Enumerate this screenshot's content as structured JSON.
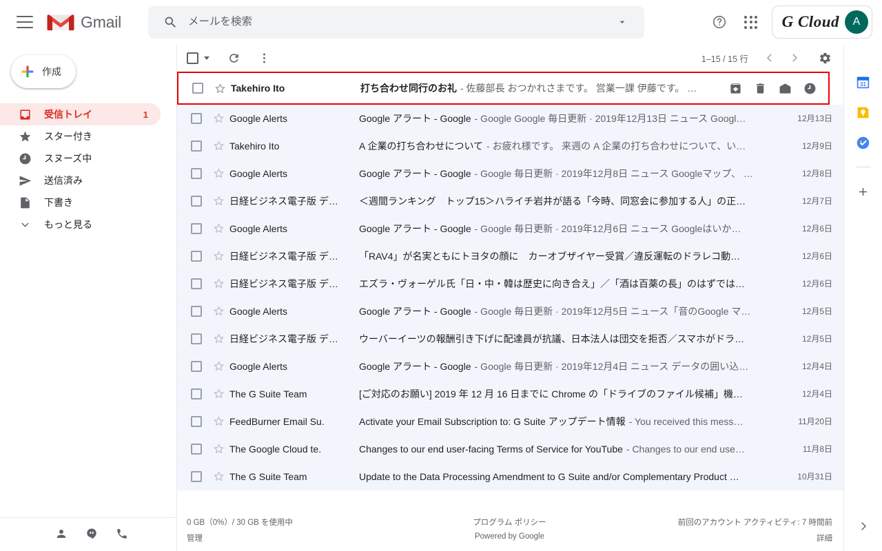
{
  "header": {
    "menu_icon": "hamburger-menu-icon",
    "brand": "Gmail",
    "search": {
      "placeholder": "メールを検索",
      "value": "",
      "icon": "search-icon",
      "options_icon": "chevron-down-icon"
    },
    "help_icon": "help-circle-icon",
    "apps_icon": "apps-grid-icon",
    "account": {
      "logo_text": "G Cloud",
      "avatar_initial": "A"
    }
  },
  "sidebar": {
    "compose_label": "作成",
    "items": [
      {
        "label": "受信トレイ",
        "icon": "inbox-icon",
        "count": "1",
        "active": true
      },
      {
        "label": "スター付き",
        "icon": "star-icon",
        "count": "",
        "active": false
      },
      {
        "label": "スヌーズ中",
        "icon": "clock-icon",
        "count": "",
        "active": false
      },
      {
        "label": "送信済み",
        "icon": "send-icon",
        "count": "",
        "active": false
      },
      {
        "label": "下書き",
        "icon": "draft-file-icon",
        "count": "",
        "active": false
      },
      {
        "label": "もっと見る",
        "icon": "chevron-down-icon",
        "count": "",
        "active": false
      }
    ],
    "footer_icons": [
      "contacts-person-icon",
      "hangouts-chat-icon",
      "phone-icon"
    ]
  },
  "toolbar": {
    "select_all_icon": "checkbox-icon",
    "select_all_caret_icon": "chevron-down-icon",
    "refresh_icon": "refresh-icon",
    "more_icon": "more-vertical-icon",
    "pagination_text": "1–15 / 15 行",
    "prev_icon": "chevron-left-icon",
    "next_icon": "chevron-right-icon",
    "settings_icon": "gear-icon"
  },
  "highlight_color": "#ea0000",
  "row_actions": [
    {
      "icon": "archive-icon"
    },
    {
      "icon": "trash-icon"
    },
    {
      "icon": "mark-as-read-envelope-icon"
    },
    {
      "icon": "snooze-clock-icon"
    }
  ],
  "emails": [
    {
      "sender": "Takehiro Ito",
      "subject": "打ち合わせ同行のお礼",
      "snippet": "- 佐藤部長 おつかれさまです。 営業一課 伊藤です。 …",
      "date": "",
      "unread": true,
      "highlighted": true
    },
    {
      "sender": "Google Alerts",
      "subject": "Google アラート - Google",
      "snippet": "- Google Google 毎日更新 · 2019年12月13日 ニュース Googl…",
      "date": "12月13日",
      "unread": false,
      "highlighted": false
    },
    {
      "sender": "Takehiro Ito",
      "subject": "A 企業の打ち合わせについて",
      "snippet": "- お疲れ様です。 来週の A 企業の打ち合わせについて、い…",
      "date": "12月9日",
      "unread": false,
      "highlighted": false
    },
    {
      "sender": "Google Alerts",
      "subject": "Google アラート - Google",
      "snippet": "- Google 毎日更新 · 2019年12月8日 ニュース Googleマップ、 …",
      "date": "12月8日",
      "unread": false,
      "highlighted": false
    },
    {
      "sender": "日経ビジネス電子版 デ…",
      "subject": "＜週間ランキング　トップ15＞ハライチ岩井が語る「今時、同窓会に参加する人」の正…",
      "snippet": "",
      "date": "12月7日",
      "unread": false,
      "highlighted": false
    },
    {
      "sender": "Google Alerts",
      "subject": "Google アラート - Google",
      "snippet": "- Google 毎日更新 · 2019年12月6日 ニュース Googleはいか…",
      "date": "12月6日",
      "unread": false,
      "highlighted": false
    },
    {
      "sender": "日経ビジネス電子版 デ…",
      "subject": "「RAV4」が名実ともにトヨタの顔に　カーオブザイヤー受賞／違反運転のドラレコ動…",
      "snippet": "",
      "date": "12月6日",
      "unread": false,
      "highlighted": false
    },
    {
      "sender": "日経ビジネス電子版 デ…",
      "subject": "エズラ・ヴォーゲル氏「日・中・韓は歴史に向き合え」／「酒は百薬の長」のはずでは…",
      "snippet": "",
      "date": "12月6日",
      "unread": false,
      "highlighted": false
    },
    {
      "sender": "Google Alerts",
      "subject": "Google アラート - Google",
      "snippet": "- Google 毎日更新 · 2019年12月5日 ニュース「音のGoogle マ…",
      "date": "12月5日",
      "unread": false,
      "highlighted": false
    },
    {
      "sender": "日経ビジネス電子版 デ…",
      "subject": "ウーバーイーツの報酬引き下げに配達員が抗議、日本法人は団交を拒否／スマホがドラ…",
      "snippet": "",
      "date": "12月5日",
      "unread": false,
      "highlighted": false
    },
    {
      "sender": "Google Alerts",
      "subject": "Google アラート - Google",
      "snippet": "- Google 毎日更新 · 2019年12月4日 ニュース データの囲い込…",
      "date": "12月4日",
      "unread": false,
      "highlighted": false
    },
    {
      "sender": "The G Suite Team",
      "subject": "[ご対応のお願い] 2019 年 12 月 16 日までに Chrome の「ドライブのファイル候補」機…",
      "snippet": "",
      "date": "12月4日",
      "unread": false,
      "highlighted": false
    },
    {
      "sender": "FeedBurner Email Su.",
      "subject": "Activate your Email Subscription to: G Suite アップデート情報",
      "snippet": "- You received this mess…",
      "date": "11月20日",
      "unread": false,
      "highlighted": false
    },
    {
      "sender": "The Google Cloud te.",
      "subject": "Changes to our end user-facing Terms of Service for YouTube",
      "snippet": "- Changes to our end use…",
      "date": "11月8日",
      "unread": false,
      "highlighted": false
    },
    {
      "sender": "The G Suite Team",
      "subject": "Update to the Data Processing Amendment to G Suite and/or Complementary Product …",
      "snippet": "",
      "date": "10月31日",
      "unread": false,
      "highlighted": false
    }
  ],
  "footer": {
    "storage_text": "0 GB（0%）/ 30 GB を使用中",
    "manage_label": "管理",
    "policy_label": "プログラム ポリシー",
    "powered_label": "Powered by Google",
    "activity_text": "前回のアカウント アクティビティ: 7 時間前",
    "details_label": "詳細"
  },
  "right_rail": {
    "icons": [
      "calendar-31-icon",
      "keep-bulb-icon",
      "tasks-check-icon"
    ],
    "add_icon": "plus-icon",
    "expand_icon": "chevron-right-icon"
  }
}
